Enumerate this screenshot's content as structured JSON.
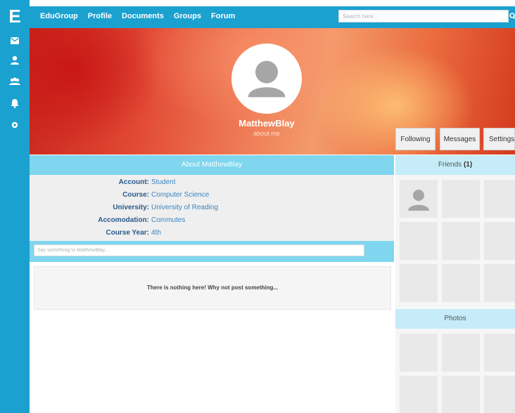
{
  "brand": {
    "logo_letter": "E"
  },
  "rail": {
    "icons": [
      "mail-icon",
      "user-icon",
      "group-icon",
      "bell-icon",
      "gear-icon"
    ]
  },
  "nav": {
    "items": [
      "EduGroup",
      "Profile",
      "Documents",
      "Groups",
      "Forum"
    ],
    "search_placeholder": "Search here..."
  },
  "profile": {
    "username": "MatthewBlay",
    "about_link": "about me"
  },
  "actions": {
    "following": "Following",
    "messages": "Messages",
    "settings": "Settings"
  },
  "about": {
    "header": "About MatthewBlay",
    "rows": [
      {
        "label": "Account:",
        "value": "Student"
      },
      {
        "label": "Course:",
        "value": "Computer Science"
      },
      {
        "label": "University:",
        "value": "University of Reading"
      },
      {
        "label": "Accomodation:",
        "value": "Commutes"
      },
      {
        "label": "Course Year:",
        "value": "4th"
      }
    ]
  },
  "post": {
    "placeholder": "Say something to MatthewBlay...",
    "empty_message": "There is nothing here! Why not post something..."
  },
  "friends": {
    "label": "Friends",
    "count": "(1)"
  },
  "photos": {
    "header": "Photos"
  },
  "colors": {
    "primary": "#1ba1cf",
    "section_header": "#7fd6ee",
    "sidebar_header": "#c5ecf8"
  }
}
